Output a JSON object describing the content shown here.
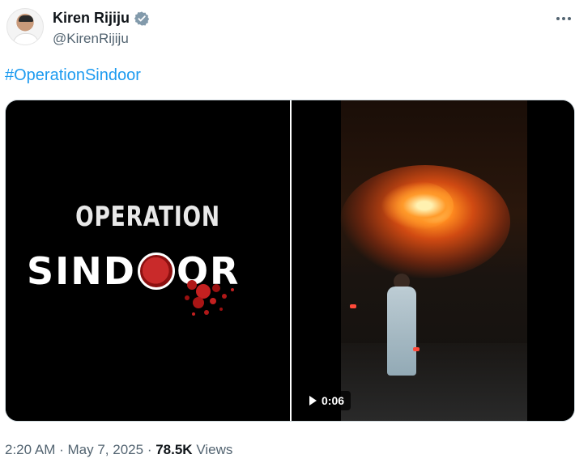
{
  "author": {
    "display_name": "Kiren Rijiju",
    "handle": "@KirenRijiju",
    "verified_icon": "verified-badge-icon"
  },
  "tweet": {
    "text": "#OperationSindoor"
  },
  "media": {
    "image": {
      "title_line1": "OPERATION",
      "title_line2_part1": "SIND",
      "title_line2_part2": "OR"
    },
    "video": {
      "duration": "0:06",
      "play_icon": "play-icon"
    }
  },
  "meta": {
    "time": "2:20 AM",
    "separator": "·",
    "date": "May 7, 2025",
    "views_count": "78.5K",
    "views_label": "Views"
  },
  "colors": {
    "accent": "#1d9bf0",
    "secondary_text": "#536471",
    "primary_text": "#0f1419"
  }
}
